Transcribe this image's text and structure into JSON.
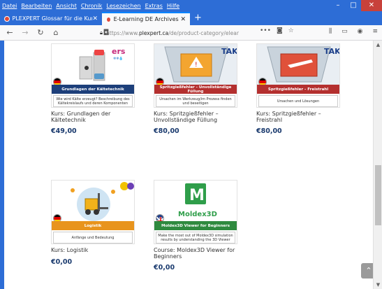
{
  "menu": [
    "Datei",
    "Bearbeiten",
    "Ansicht",
    "Chronik",
    "Lesezeichen",
    "Extras",
    "Hilfe"
  ],
  "tabs": [
    {
      "label": "PLEXPERT Glossar für die Kunst"
    },
    {
      "label": "E-Learning DE Archives - PLEXP"
    }
  ],
  "url": {
    "prefix": "https://www.",
    "domain": "plexpert.ca",
    "path": "/de/product-category/elear"
  },
  "products": [
    {
      "banner": "Grundlagen der Kältetechnik",
      "desc": "Wie wird Kälte erzeugt? Beschreibung des Kältekreislaufs und deren Komponenten",
      "title": "Kurs: Grundlagen der Kältetechnik",
      "price": "€49,00",
      "banner_color": "#1d3f7a",
      "logo": "ers"
    },
    {
      "banner": "Spritzgießfehler - Unvollständige Füllung",
      "desc": "Ursachen im Werkzeug/im Prozess finden und beseitigen",
      "title": "Kurs: Spritzgießfehler – Unvollständige Füllung",
      "price": "€80,00",
      "banner_color": "#b4302f",
      "logo": "TAK"
    },
    {
      "banner": "Spritzgießfehler - Freistrahl",
      "desc": "Ursachen und Lösungen",
      "title": "Kurs: Spritzgießfehler – Freistrahl",
      "price": "€80,00",
      "banner_color": "#b4302f",
      "logo": "TAK"
    },
    {
      "banner": "Logistik",
      "desc": "Anfänge und Bedeutung",
      "title": "Kurs: Logistik",
      "price": "€0,00",
      "banner_color": "#e8941d",
      "logo": ""
    },
    {
      "banner": "Moldex3D Viewer for Beginners",
      "desc": "Make the most out of Moldex3D simulation results by understanding the 3D Viewer",
      "title": "Course: Moldex3D Viewer for Beginners",
      "price": "€0,00",
      "banner_color": "#2f8a3f",
      "logo": "Moldex3D"
    }
  ]
}
